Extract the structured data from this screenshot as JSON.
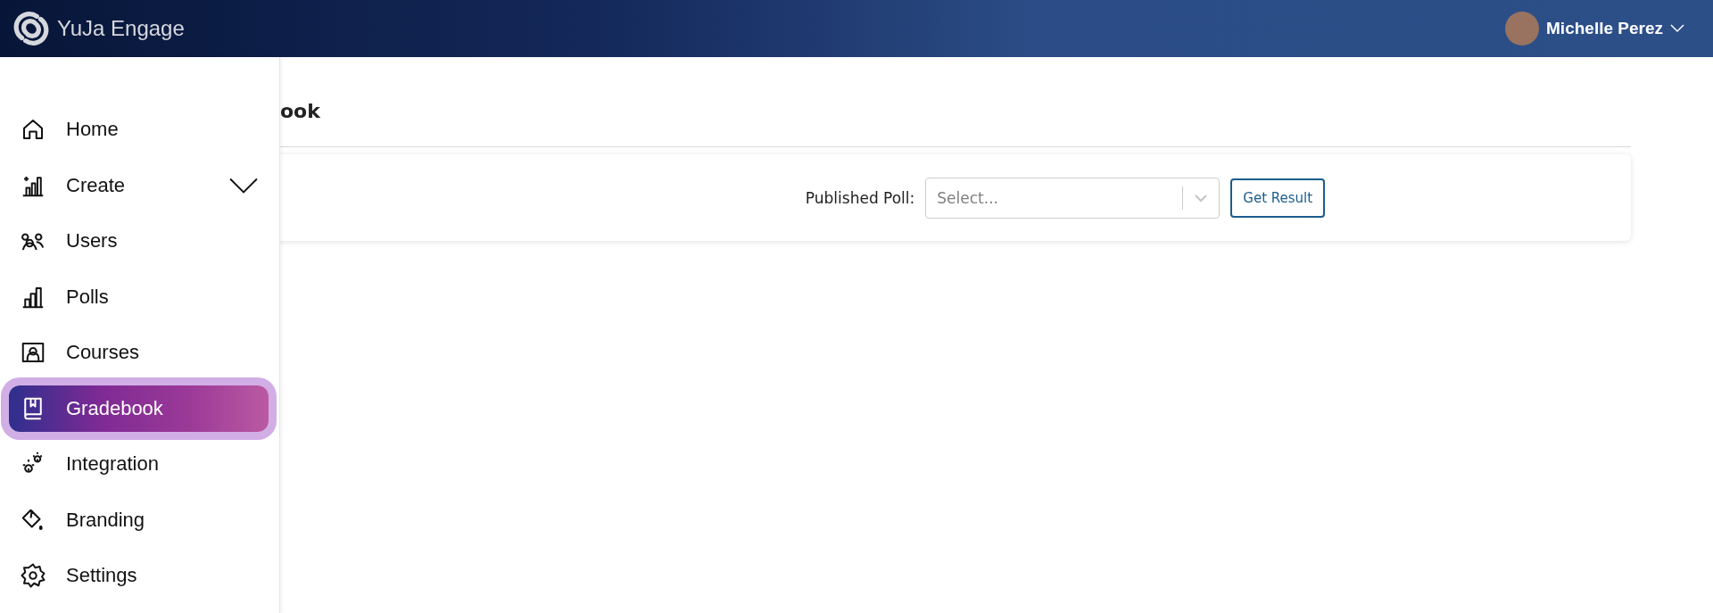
{
  "header": {
    "brand": "YuJa Engage",
    "user": {
      "name": "Michelle Perez"
    }
  },
  "sidebar": {
    "items": [
      {
        "label": "Home",
        "kind": "link",
        "selected": false
      },
      {
        "label": "Create",
        "kind": "group",
        "expanded": false,
        "selected": false
      },
      {
        "label": "Users",
        "kind": "link",
        "selected": false
      },
      {
        "label": "Polls",
        "kind": "link",
        "selected": false
      },
      {
        "label": "Courses",
        "kind": "link",
        "selected": false
      },
      {
        "label": "Gradebook",
        "kind": "link",
        "selected": true
      },
      {
        "label": "Integration",
        "kind": "link",
        "selected": false
      },
      {
        "label": "Branding",
        "kind": "link",
        "selected": false
      },
      {
        "label": "Settings",
        "kind": "link",
        "selected": false
      }
    ]
  },
  "main": {
    "title": "ook",
    "filter": {
      "label": "Published Poll:",
      "placeholder": "Select...",
      "button": "Get Result"
    }
  }
}
